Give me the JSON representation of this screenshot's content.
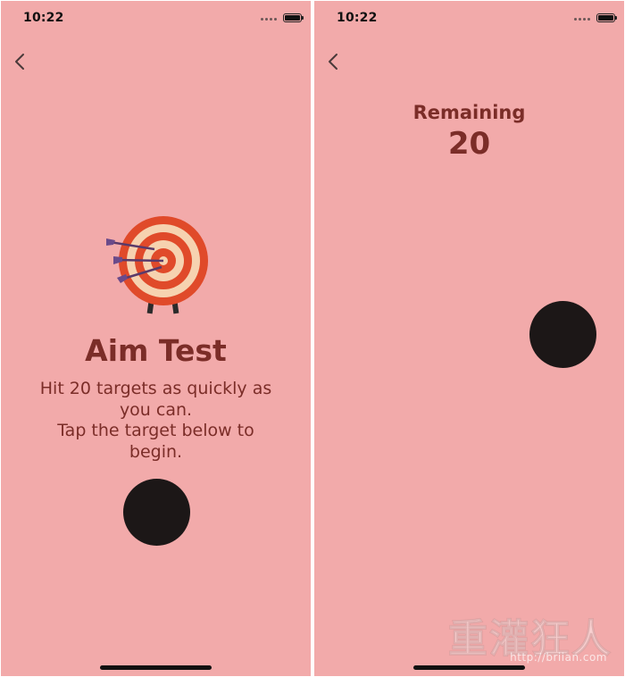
{
  "status_bar": {
    "time": "10:22"
  },
  "icons": {
    "back": "chevron-left-icon",
    "signal": "signal-dots-icon",
    "battery": "battery-icon",
    "target_image": "archery-target-icon"
  },
  "intro_screen": {
    "title": "Aim Test",
    "instructions": "Hit 20 targets as quickly as you can.\nTap the target below to begin."
  },
  "game_screen": {
    "remaining_label": "Remaining",
    "remaining_count": "20"
  },
  "watermark": {
    "logo_text": "重灌狂人",
    "url": "http://briian.com"
  },
  "colors": {
    "background": "#f2aaaa",
    "text": "#7b2d28",
    "target": "#1c1717"
  }
}
